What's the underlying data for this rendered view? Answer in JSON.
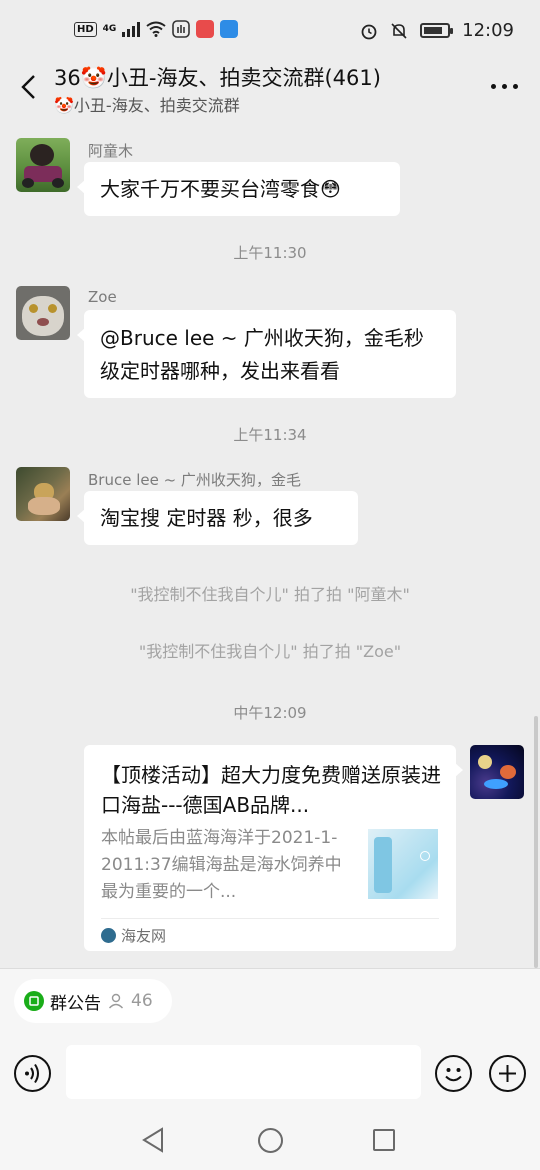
{
  "status_bar": {
    "network": "HD",
    "signal": "4G",
    "time": "12:09"
  },
  "header": {
    "title": "36🤡小丑-海友、拍卖交流群(461)",
    "subtitle": "🤡小丑-海友、拍卖交流群"
  },
  "messages": [
    {
      "sender": "阿童木",
      "text": "大家千万不要买台湾零食😳"
    },
    {
      "time": "上午11:30"
    },
    {
      "sender": "Zoe",
      "text": "@Bruce lee ~ 广州收天狗，金毛秒级定时器哪种，发出来看看"
    },
    {
      "time": "上午11:34"
    },
    {
      "sender": "Bruce lee ~ 广州收天狗，金毛",
      "text": "淘宝搜 定时器 秒，很多"
    },
    {
      "system": "\"我控制不住我自个儿\" 拍了拍 \"阿童木\""
    },
    {
      "system": "\"我控制不住我自个儿\" 拍了拍 \"Zoe\""
    },
    {
      "time": "中午12:09"
    }
  ],
  "link_card": {
    "title": "【顶楼活动】超大力度免费赠送原装进口海盐---德国AB品牌...",
    "description": "本帖最后由蓝海海洋于2021-1-2011:37编辑海盐是海水饲养中最为重要的一个...",
    "source": "海友网"
  },
  "bottom": {
    "notice_label": "群公告",
    "member_count": "46"
  },
  "icons": {
    "back": "chevron-left-icon",
    "more": "more-dots-icon",
    "voice": "voice-icon",
    "emoji": "emoji-icon",
    "plus": "plus-icon"
  }
}
